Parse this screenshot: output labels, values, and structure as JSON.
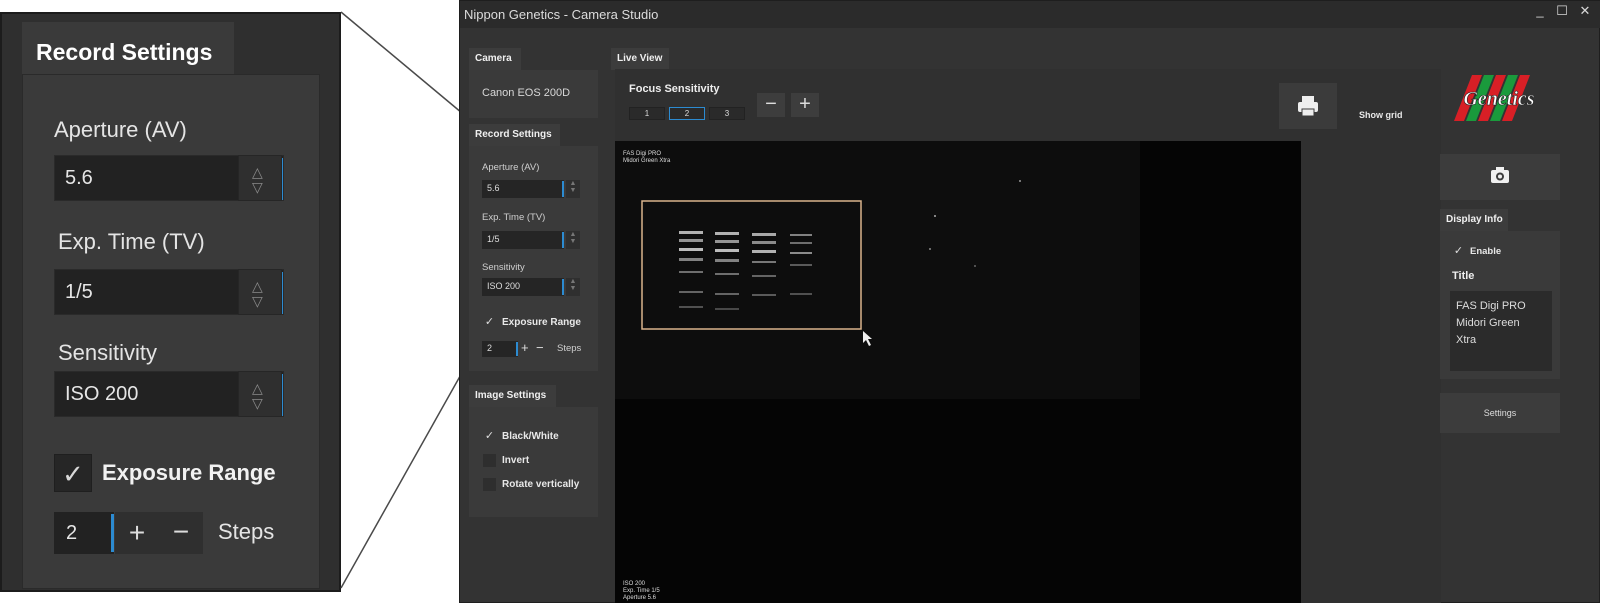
{
  "zoom": {
    "title": "Record Settings",
    "aperture_label": "Aperture (AV)",
    "aperture_value": "5.6",
    "exptime_label": "Exp. Time (TV)",
    "exptime_value": "1/5",
    "sensitivity_label": "Sensitivity",
    "sensitivity_value": "ISO 200",
    "exposure_range_label": "Exposure Range",
    "steps_value": "2",
    "steps_label": "Steps"
  },
  "window": {
    "title": "Nippon Genetics - Camera Studio",
    "min": "_",
    "max": "☐",
    "close": "✕"
  },
  "camera": {
    "header": "Camera",
    "model": "Canon EOS 200D"
  },
  "record": {
    "header": "Record Settings",
    "aperture_label": "Aperture (AV)",
    "aperture_value": "5.6",
    "exptime_label": "Exp. Time (TV)",
    "exptime_value": "1/5",
    "sensitivity_label": "Sensitivity",
    "sensitivity_value": "ISO 200",
    "exposure_range_label": "Exposure Range",
    "steps_value": "2",
    "steps_label": "Steps"
  },
  "image_settings": {
    "header": "Image Settings",
    "bw_label": "Black/White",
    "invert_label": "Invert",
    "rotate_label": "Rotate vertically"
  },
  "live_view": {
    "header": "Live View",
    "focus_label": "Focus Sensitivity",
    "focus_options": [
      "1",
      "2",
      "3"
    ],
    "minus": "−",
    "plus": "+",
    "show_grid_label": "Show grid",
    "overlay_top": [
      "FAS Digi PRO",
      "Midori Green Xtra"
    ],
    "overlay_bottom": [
      "ISO 200",
      "Exp. Time 1/5",
      "Aperture 5.6"
    ]
  },
  "brand": {
    "logo_text": "Genetics"
  },
  "display_info": {
    "header": "Display Info",
    "enable_label": "Enable",
    "title_label": "Title",
    "title_lines": [
      "FAS Digi PRO",
      "Midori Green",
      "Xtra"
    ]
  },
  "settings_button": "Settings",
  "colors": {
    "accent": "#2c8bd1",
    "panel": "#3a3a3a",
    "background": "#333333",
    "logo_red": "#d81f26",
    "logo_green": "#1a9a3c"
  }
}
